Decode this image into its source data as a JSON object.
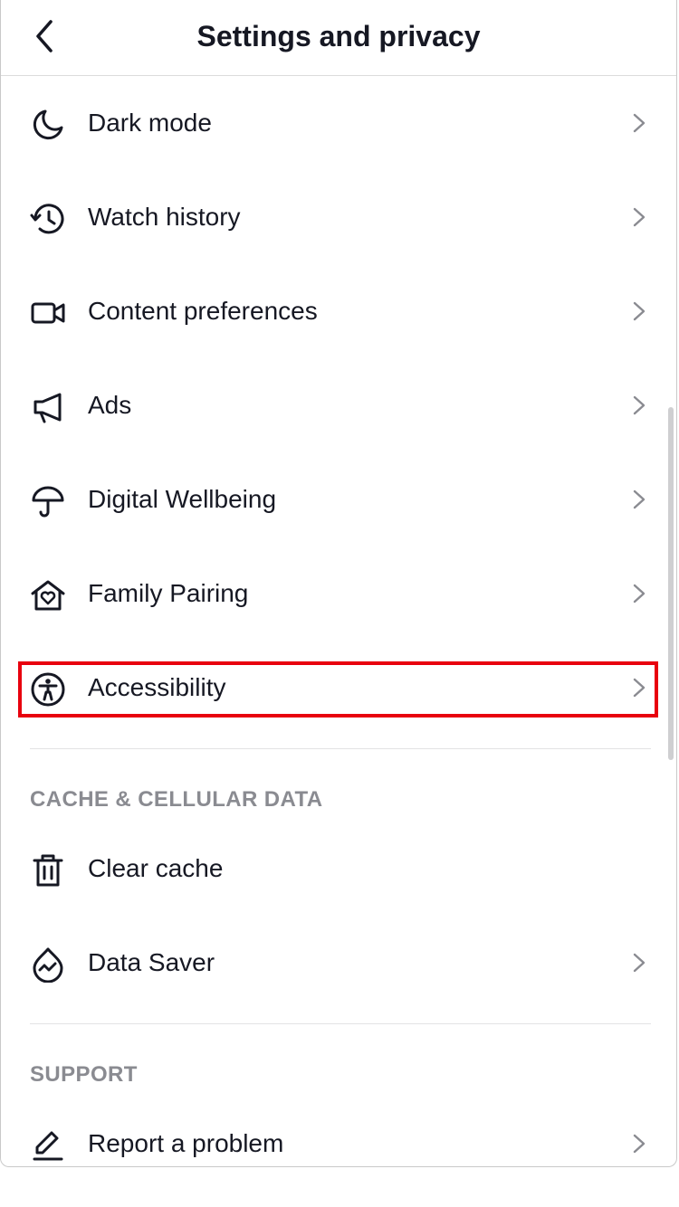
{
  "header": {
    "title": "Settings and privacy",
    "back_icon": "chevron-left-icon"
  },
  "rows": [
    {
      "label": "Dark mode",
      "icon": "moon-icon",
      "chevron": true
    },
    {
      "label": "Watch history",
      "icon": "history-icon",
      "chevron": true
    },
    {
      "label": "Content preferences",
      "icon": "video-camera-icon",
      "chevron": true
    },
    {
      "label": "Ads",
      "icon": "megaphone-icon",
      "chevron": true
    },
    {
      "label": "Digital Wellbeing",
      "icon": "umbrella-icon",
      "chevron": true
    },
    {
      "label": "Family Pairing",
      "icon": "house-heart-icon",
      "chevron": true
    },
    {
      "label": "Accessibility",
      "icon": "accessibility-icon",
      "chevron": true,
      "highlighted": true
    }
  ],
  "sections": {
    "cache": {
      "title": "CACHE & CELLULAR DATA",
      "rows": [
        {
          "label": "Clear cache",
          "icon": "trash-icon",
          "chevron": false
        },
        {
          "label": "Data Saver",
          "icon": "data-saver-icon",
          "chevron": true
        }
      ]
    },
    "support": {
      "title": "SUPPORT",
      "rows": [
        {
          "label": "Report a problem",
          "icon": "pencil-icon",
          "chevron": true
        }
      ]
    }
  },
  "colors": {
    "text": "#161823",
    "section_title": "#8a8b91",
    "highlight_border": "#e8000e",
    "divider": "#e3e3e4"
  }
}
